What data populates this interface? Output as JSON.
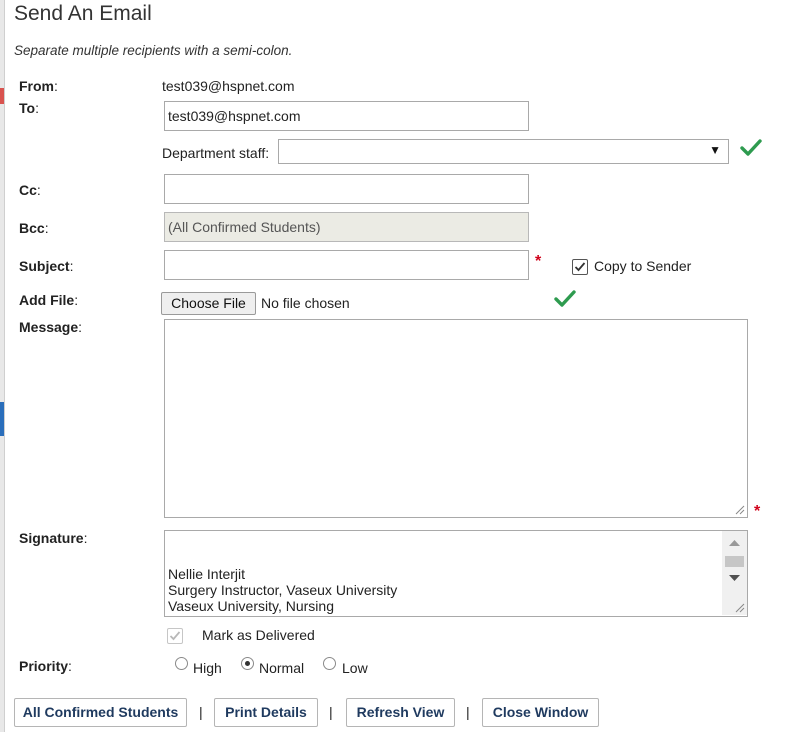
{
  "page": {
    "title": "Send An Email",
    "instruction": "Separate multiple recipients with a semi-colon."
  },
  "form": {
    "from": {
      "label": "From",
      "value": "test039@hspnet.com"
    },
    "to": {
      "label": "To",
      "value": "test039@hspnet.com"
    },
    "department_staff": {
      "label": "Department staff:",
      "selected": ""
    },
    "cc": {
      "label": "Cc",
      "value": ""
    },
    "bcc": {
      "label": "Bcc",
      "value": "(All Confirmed Students)"
    },
    "subject": {
      "label": "Subject",
      "value": "",
      "required_marker": "*"
    },
    "copy_to_sender": {
      "label": "Copy to Sender",
      "checked": true
    },
    "add_file": {
      "label": "Add File",
      "button_label": "Choose File",
      "status": "No file chosen"
    },
    "message": {
      "label": "Message",
      "value": "",
      "required_marker": "*"
    },
    "signature": {
      "label": "Signature",
      "lines": [
        "Nellie Interjit",
        "Surgery Instructor, Vaseux University",
        "Vaseux University, Nursing"
      ]
    },
    "mark_delivered": {
      "label": "Mark as Delivered",
      "checked": true,
      "disabled": true
    },
    "priority": {
      "label": "Priority",
      "options": [
        {
          "label": "High",
          "checked": false
        },
        {
          "label": "Normal",
          "checked": true
        },
        {
          "label": "Low",
          "checked": false
        }
      ]
    }
  },
  "actions": {
    "buttons": [
      "All Confirmed Students",
      "Print Details",
      "Refresh View",
      "Close Window"
    ],
    "separator": "|"
  },
  "colors": {
    "check_green": "#2e9b4f",
    "required_red": "#d0021b",
    "button_text": "#1f3a5f"
  },
  "icons": {
    "valid": "checkmark-icon",
    "dropdown": "chevron-down-icon",
    "resize": "resize-grip-icon"
  }
}
